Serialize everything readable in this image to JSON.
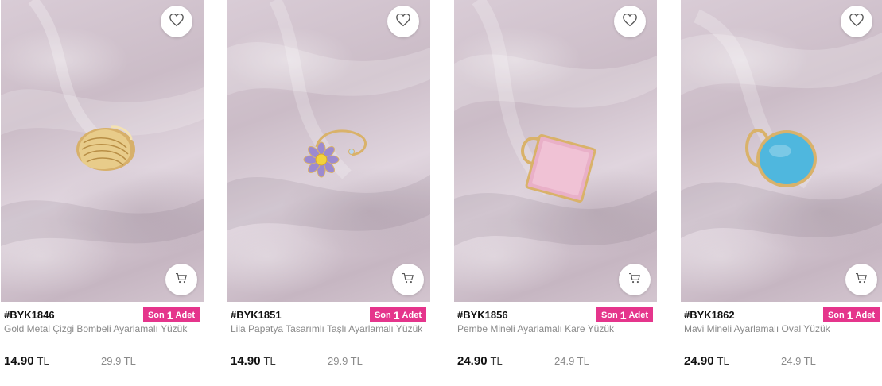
{
  "products": [
    {
      "code": "#BYK1846",
      "stock": {
        "prefix": "Son",
        "count": "1",
        "suffix": "Adet"
      },
      "name": "Gold Metal Çizgi Bombeli Ayarlamalı Yüzük",
      "price": "14.90",
      "currency": "TL",
      "old_price": "29.9 TL",
      "ring": "gold-ribbed-ring"
    },
    {
      "code": "#BYK1851",
      "stock": {
        "prefix": "Son",
        "count": "1",
        "suffix": "Adet"
      },
      "name": "Lila Papatya Tasarımlı Taşlı Ayarlamalı Yüzük",
      "price": "14.90",
      "currency": "TL",
      "old_price": "29.9 TL",
      "ring": "lilac-daisy-ring"
    },
    {
      "code": "#BYK1856",
      "stock": {
        "prefix": "Son",
        "count": "1",
        "suffix": "Adet"
      },
      "name": "Pembe Mineli Ayarlamalı Kare Yüzük",
      "price": "24.90",
      "currency": "TL",
      "old_price": "24.9 TL",
      "ring": "pink-square-ring"
    },
    {
      "code": "#BYK1862",
      "stock": {
        "prefix": "Son",
        "count": "1",
        "suffix": "Adet"
      },
      "name": "Mavi Mineli Ayarlamalı Oval Yüzük",
      "price": "24.90",
      "currency": "TL",
      "old_price": "24.9 TL",
      "ring": "blue-oval-ring"
    }
  ],
  "icons": {
    "favorite": "heart-icon",
    "cart": "cart-icon"
  },
  "colors": {
    "stock_badge": "#e5358c",
    "price_text": "#111111",
    "muted_text": "#8a8a8a"
  }
}
